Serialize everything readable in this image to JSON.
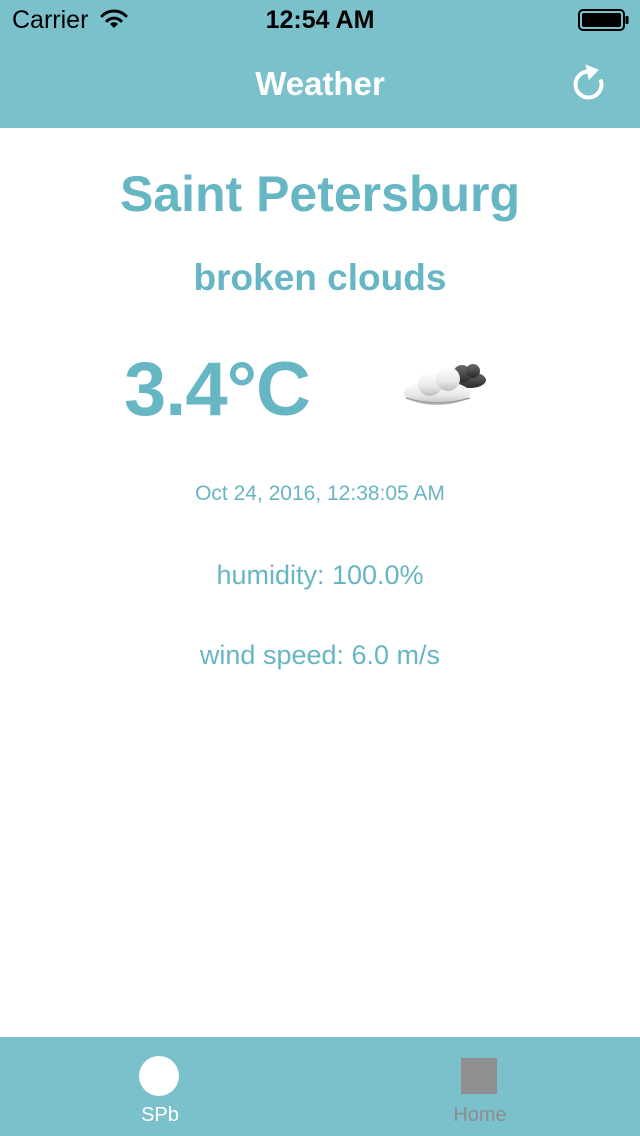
{
  "status_bar": {
    "carrier": "Carrier",
    "time": "12:54 AM",
    "wifi_icon": "wifi-icon",
    "battery_icon": "battery-icon"
  },
  "nav": {
    "title": "Weather",
    "refresh_icon": "refresh-icon"
  },
  "weather": {
    "city": "Saint Petersburg",
    "description": "broken clouds",
    "temperature": "3.4°C",
    "icon": "broken-clouds-icon",
    "timestamp": "Oct 24, 2016, 12:38:05 AM",
    "humidity": "humidity: 100.0%",
    "wind_speed": "wind speed: 6.0 m/s"
  },
  "tabs": [
    {
      "label": "SPb",
      "icon": "circle-icon",
      "selected": true
    },
    {
      "label": "Home",
      "icon": "square-icon",
      "selected": false
    }
  ],
  "colors": {
    "bar_background": "#7bc1cc",
    "accent_text": "#66b6c4",
    "selected_tab": "#ffffff",
    "unselected_tab": "#8f8f8f"
  }
}
